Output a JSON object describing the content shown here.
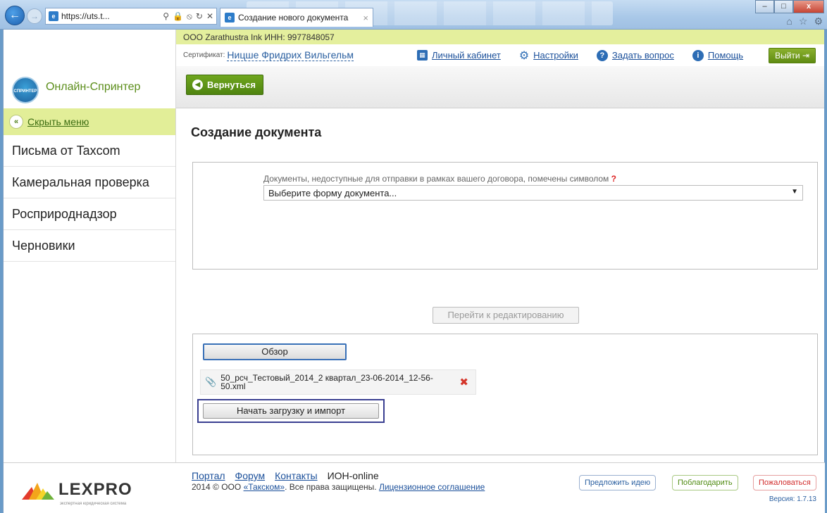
{
  "browser": {
    "address": "https://uts.t...",
    "tab_title": "Создание нового документа",
    "tab_close": "×",
    "win_min": "–",
    "win_max": "□",
    "win_close": "x",
    "icons": [
      "back-icon",
      "forward-icon",
      "search-icon",
      "lock-icon",
      "refresh-icon",
      "stop-icon",
      "home-icon",
      "star-icon",
      "gear-icon"
    ]
  },
  "header": {
    "org": "ООО Zarathustra Ink ИНН: 9977848057",
    "logo_text": "Онлайн-Спринтер",
    "logo_badge": "СПРИНТЕР",
    "cert_label": "Сертификат:",
    "cert_name": "Ницше Фридрих Вильгельм",
    "links": {
      "cabinet": "Личный кабинет",
      "settings": "Настройки",
      "ask": "Задать вопрос",
      "help": "Помощь"
    },
    "logout": "Выйти"
  },
  "toolbar": {
    "back": "Вернуться"
  },
  "sidebar": {
    "hide_menu": "Скрыть меню",
    "items": [
      {
        "label": "Письма от Taxcom"
      },
      {
        "label": "Камеральная проверка"
      },
      {
        "label": "Росприроднадзор"
      },
      {
        "label": "Черновики"
      }
    ]
  },
  "main": {
    "title": "Создание документа",
    "hint": "Документы, недоступные для отправки в рамках вашего договора, помечены символом",
    "hint_mark": "?",
    "select_value": "Выберите форму документа...",
    "goto_edit": "Перейти к редактированию",
    "browse": "Обзор",
    "file_name": "50_рсч_Тестовый_2014_2 квартал_23-06-2014_12-56-50.xml",
    "upload": "Начать загрузку и импорт"
  },
  "footer": {
    "brand": "LEXPRO",
    "brand_sub": "экспертная юридическая система",
    "links": {
      "portal": "Портал",
      "forum": "Форум",
      "contacts": "Контакты",
      "ion": "ИОН-online"
    },
    "copyright_pre": "2014 © ООО",
    "copyright_company": "«Такском»",
    "copyright_mid": ". Все права защищены.",
    "license": "Лицензионное соглашение",
    "suggest": "Предложить идею",
    "thanks": "Поблагодарить",
    "complain": "Пожаловаться",
    "version": "Версия: 1.7.13"
  },
  "colors": {
    "accent_green": "#5f8b12",
    "header_lime": "#e4ef9d",
    "link_blue": "#1a4f9a",
    "focus_outline": "#3a3f91"
  }
}
